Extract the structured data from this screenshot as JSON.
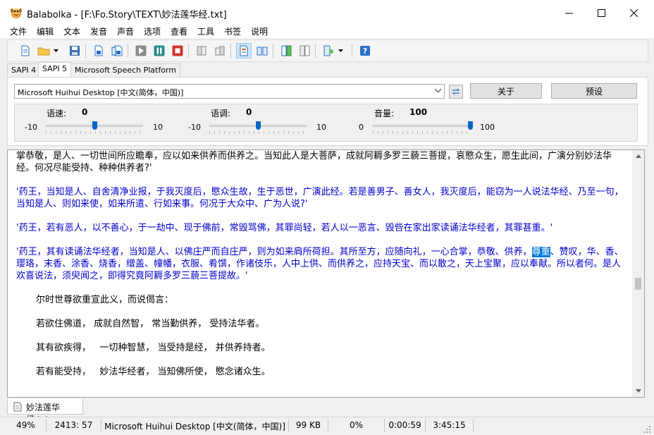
{
  "window": {
    "title": "Balabolka - [F:\\Fo.Story\\TEXT\\妙法莲华经.txt]",
    "controls": {
      "minimize": "—",
      "maximize": "☐",
      "close": "✕"
    }
  },
  "menu": [
    "文件",
    "编辑",
    "文本",
    "发音",
    "声音",
    "选项",
    "查看",
    "工具",
    "书签",
    "说明"
  ],
  "tabs": [
    "SAPI 4",
    "SAPI 5",
    "Microsoft Speech Platform"
  ],
  "voice": {
    "selected": "Microsoft Huihui Desktop [中文(简体，中国)]",
    "about_label": "关于",
    "preset_label": "预设"
  },
  "sliders": {
    "rate": {
      "label": "语速:",
      "value": "0",
      "min": "-10",
      "max": "10"
    },
    "pitch": {
      "label": "语调:",
      "value": "0",
      "min": "-10",
      "max": "10"
    },
    "volume": {
      "label": "音量:",
      "value": "100",
      "min": "0",
      "max": "100"
    }
  },
  "text": {
    "p1": "掌恭敬，是人、一切世间所应瞻奉，应以如来供养而供养之。当知此人是大菩萨，成就阿耨多罗三藐三菩提，哀愍众生，愿生此间，广演分别妙法华经。何况尽能受持、种种供养者?'",
    "p2": "'药王，当知是人、自舍清净业报，于我灭度后，愍众生故，生于恶世，广演此经。若是善男子、善女人，我灭度后，能窃为一人说法华经、乃至一句，当知是人、则如来使，如来所遣、行如来事。何况于大众中、广为人说?'",
    "p3": "'药王，若有恶人，以不善心，于一劫中、现于佛前，常毁骂佛，其罪尚轻，若人以一恶言、毁呰在家出家读诵法华经者，其罪甚重。'",
    "p4a": "'药王，其有读诵法华经者，当知是人、以佛庄严而自庄严，则为如来肩所荷担。其所至方，应随向礼，一心合掌，恭敬、供养，",
    "p4hl": "尊重",
    "p4b": "、赞叹，华、香、璎珞，末香、涂香、烧香，缯盖、幢幡，衣服、肴馔，作诸伎乐，人中上供、而供养之，应持天宝、而以散之，天上宝聚，应以奉献。所以者何。是人欢喜说法，须臾闻之，即得究竟阿耨多罗三藐三菩提故。'",
    "p5": "尔时世尊欲重宣此义，而说偈言：",
    "p6": "若欲住佛道， 成就自然智， 常当勤供养， 受持法华者。",
    "p7": "其有欲疾得，   一切种智慧， 当受持是经， 并供养持者。",
    "p8": "若有能受持，   妙法华经者， 当知佛所使， 愍念诸众生。"
  },
  "document_tab": "妙法莲华经.txt",
  "status": {
    "percent": "49%",
    "position": "2413:  57",
    "voice": "Microsoft Huihui Desktop [中文(简体，中国)]",
    "size": "99 KB",
    "progress": "0%",
    "elapsed": "0:00:59",
    "total": "3:45:15"
  },
  "colors": {
    "spoken_text": "#0000cc",
    "selection": "#0078d7",
    "slider_thumb": "#0a64c8"
  },
  "slider_levels": {
    "rate": 0.5,
    "pitch": 0.5,
    "volume": 1.0
  }
}
